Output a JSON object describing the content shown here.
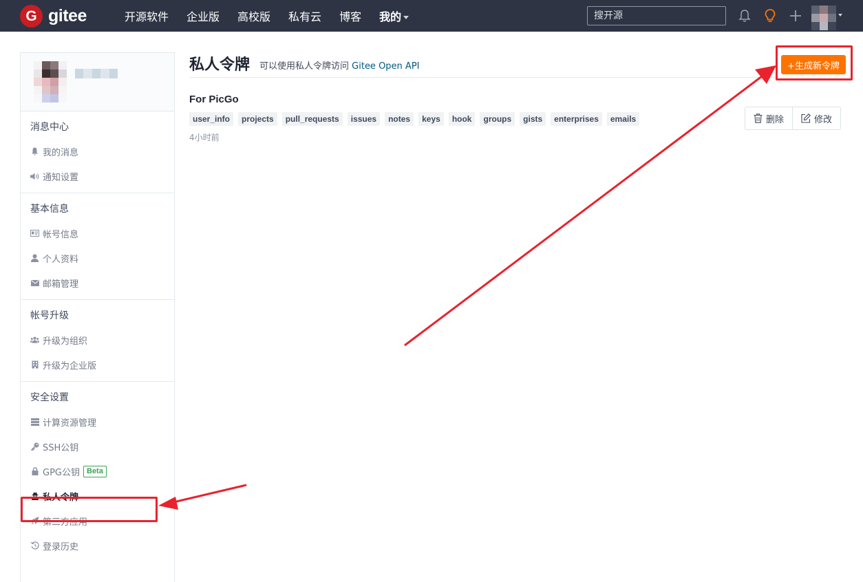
{
  "navbar": {
    "logo_letter": "G",
    "logo_text": "gitee",
    "links": [
      "开源软件",
      "企业版",
      "高校版",
      "私有云",
      "博客"
    ],
    "mine_label": "我的",
    "search_placeholder": "搜开源",
    "icons": [
      "bell-icon",
      "lightbulb-icon",
      "plus-icon"
    ],
    "accent": "#fe7300",
    "bg": "#2e3444"
  },
  "sidebar": {
    "sections": [
      {
        "title": "消息中心",
        "items": [
          {
            "label": "我的消息",
            "icon": "bell-icon"
          },
          {
            "label": "通知设置",
            "icon": "speaker-icon"
          }
        ]
      },
      {
        "title": "基本信息",
        "items": [
          {
            "label": "帐号信息",
            "icon": "id-card-icon"
          },
          {
            "label": "个人资料",
            "icon": "user-icon"
          },
          {
            "label": "邮箱管理",
            "icon": "envelope-icon"
          }
        ]
      },
      {
        "title": "帐号升级",
        "items": [
          {
            "label": "升级为组织",
            "icon": "users-icon"
          },
          {
            "label": "升级为企业版",
            "icon": "building-icon"
          }
        ]
      },
      {
        "title": "安全设置",
        "items": [
          {
            "label": "计算资源管理",
            "icon": "server-icon"
          },
          {
            "label": "SSH公钥",
            "icon": "key-icon"
          },
          {
            "label": "GPG公钥",
            "icon": "lock-icon",
            "badge": "Beta"
          },
          {
            "label": "私人令牌",
            "icon": "user-secret-icon",
            "active": true
          },
          {
            "label": "第三方应用",
            "icon": "rocket-icon"
          },
          {
            "label": "登录历史",
            "icon": "history-icon"
          }
        ]
      }
    ]
  },
  "main": {
    "title": "私人令牌",
    "desc_prefix": "可以使用私人令牌访问",
    "desc_link": "Gitee Open API",
    "generate_button": "+生成新令牌",
    "token": {
      "name": "For PicGo",
      "scopes": [
        "user_info",
        "projects",
        "pull_requests",
        "issues",
        "notes",
        "keys",
        "hook",
        "groups",
        "gists",
        "enterprises",
        "emails"
      ],
      "time": "4小时前",
      "delete_label": "删除",
      "edit_label": "修改"
    }
  },
  "annotation_color": "#e8232d"
}
